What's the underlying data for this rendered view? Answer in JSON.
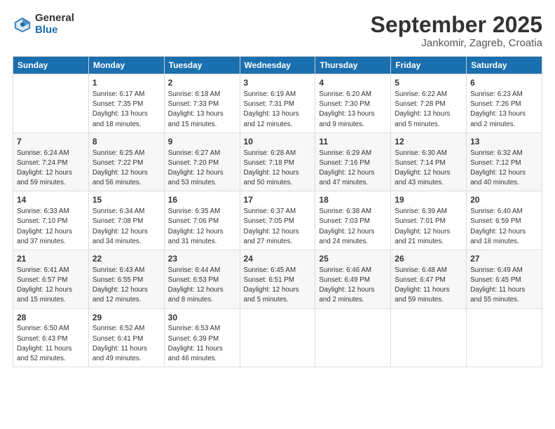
{
  "logo": {
    "general": "General",
    "blue": "Blue"
  },
  "header": {
    "month": "September 2025",
    "location": "Jankomir, Zagreb, Croatia"
  },
  "weekdays": [
    "Sunday",
    "Monday",
    "Tuesday",
    "Wednesday",
    "Thursday",
    "Friday",
    "Saturday"
  ],
  "weeks": [
    [
      {
        "day": "",
        "info": ""
      },
      {
        "day": "1",
        "info": "Sunrise: 6:17 AM\nSunset: 7:35 PM\nDaylight: 13 hours\nand 18 minutes."
      },
      {
        "day": "2",
        "info": "Sunrise: 6:18 AM\nSunset: 7:33 PM\nDaylight: 13 hours\nand 15 minutes."
      },
      {
        "day": "3",
        "info": "Sunrise: 6:19 AM\nSunset: 7:31 PM\nDaylight: 13 hours\nand 12 minutes."
      },
      {
        "day": "4",
        "info": "Sunrise: 6:20 AM\nSunset: 7:30 PM\nDaylight: 13 hours\nand 9 minutes."
      },
      {
        "day": "5",
        "info": "Sunrise: 6:22 AM\nSunset: 7:28 PM\nDaylight: 13 hours\nand 5 minutes."
      },
      {
        "day": "6",
        "info": "Sunrise: 6:23 AM\nSunset: 7:26 PM\nDaylight: 13 hours\nand 2 minutes."
      }
    ],
    [
      {
        "day": "7",
        "info": "Sunrise: 6:24 AM\nSunset: 7:24 PM\nDaylight: 12 hours\nand 59 minutes."
      },
      {
        "day": "8",
        "info": "Sunrise: 6:25 AM\nSunset: 7:22 PM\nDaylight: 12 hours\nand 56 minutes."
      },
      {
        "day": "9",
        "info": "Sunrise: 6:27 AM\nSunset: 7:20 PM\nDaylight: 12 hours\nand 53 minutes."
      },
      {
        "day": "10",
        "info": "Sunrise: 6:28 AM\nSunset: 7:18 PM\nDaylight: 12 hours\nand 50 minutes."
      },
      {
        "day": "11",
        "info": "Sunrise: 6:29 AM\nSunset: 7:16 PM\nDaylight: 12 hours\nand 47 minutes."
      },
      {
        "day": "12",
        "info": "Sunrise: 6:30 AM\nSunset: 7:14 PM\nDaylight: 12 hours\nand 43 minutes."
      },
      {
        "day": "13",
        "info": "Sunrise: 6:32 AM\nSunset: 7:12 PM\nDaylight: 12 hours\nand 40 minutes."
      }
    ],
    [
      {
        "day": "14",
        "info": "Sunrise: 6:33 AM\nSunset: 7:10 PM\nDaylight: 12 hours\nand 37 minutes."
      },
      {
        "day": "15",
        "info": "Sunrise: 6:34 AM\nSunset: 7:08 PM\nDaylight: 12 hours\nand 34 minutes."
      },
      {
        "day": "16",
        "info": "Sunrise: 6:35 AM\nSunset: 7:06 PM\nDaylight: 12 hours\nand 31 minutes."
      },
      {
        "day": "17",
        "info": "Sunrise: 6:37 AM\nSunset: 7:05 PM\nDaylight: 12 hours\nand 27 minutes."
      },
      {
        "day": "18",
        "info": "Sunrise: 6:38 AM\nSunset: 7:03 PM\nDaylight: 12 hours\nand 24 minutes."
      },
      {
        "day": "19",
        "info": "Sunrise: 6:39 AM\nSunset: 7:01 PM\nDaylight: 12 hours\nand 21 minutes."
      },
      {
        "day": "20",
        "info": "Sunrise: 6:40 AM\nSunset: 6:59 PM\nDaylight: 12 hours\nand 18 minutes."
      }
    ],
    [
      {
        "day": "21",
        "info": "Sunrise: 6:41 AM\nSunset: 6:57 PM\nDaylight: 12 hours\nand 15 minutes."
      },
      {
        "day": "22",
        "info": "Sunrise: 6:43 AM\nSunset: 6:55 PM\nDaylight: 12 hours\nand 12 minutes."
      },
      {
        "day": "23",
        "info": "Sunrise: 6:44 AM\nSunset: 6:53 PM\nDaylight: 12 hours\nand 8 minutes."
      },
      {
        "day": "24",
        "info": "Sunrise: 6:45 AM\nSunset: 6:51 PM\nDaylight: 12 hours\nand 5 minutes."
      },
      {
        "day": "25",
        "info": "Sunrise: 6:46 AM\nSunset: 6:49 PM\nDaylight: 12 hours\nand 2 minutes."
      },
      {
        "day": "26",
        "info": "Sunrise: 6:48 AM\nSunset: 6:47 PM\nDaylight: 11 hours\nand 59 minutes."
      },
      {
        "day": "27",
        "info": "Sunrise: 6:49 AM\nSunset: 6:45 PM\nDaylight: 11 hours\nand 55 minutes."
      }
    ],
    [
      {
        "day": "28",
        "info": "Sunrise: 6:50 AM\nSunset: 6:43 PM\nDaylight: 11 hours\nand 52 minutes."
      },
      {
        "day": "29",
        "info": "Sunrise: 6:52 AM\nSunset: 6:41 PM\nDaylight: 11 hours\nand 49 minutes."
      },
      {
        "day": "30",
        "info": "Sunrise: 6:53 AM\nSunset: 6:39 PM\nDaylight: 11 hours\nand 46 minutes."
      },
      {
        "day": "",
        "info": ""
      },
      {
        "day": "",
        "info": ""
      },
      {
        "day": "",
        "info": ""
      },
      {
        "day": "",
        "info": ""
      }
    ]
  ]
}
